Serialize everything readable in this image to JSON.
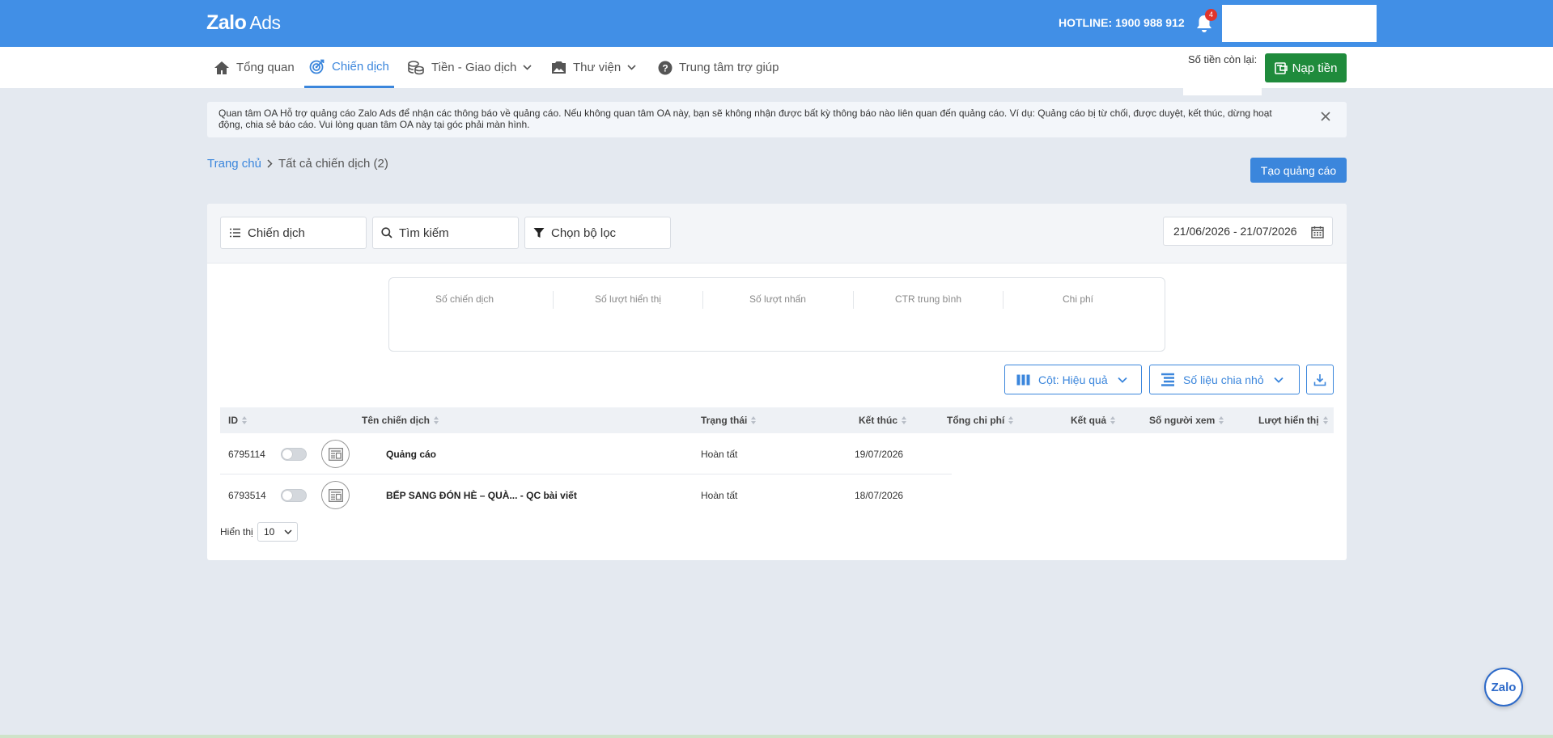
{
  "header": {
    "logo_main": "Zalo",
    "logo_sub": "Ads",
    "hotline": "HOTLINE: 1900 988 912",
    "notification_count": "4",
    "accent_color": "#418fe6"
  },
  "nav": {
    "items": [
      {
        "label": "Tổng quan",
        "icon": "home-icon"
      },
      {
        "label": "Chiến dịch",
        "icon": "target-icon",
        "active": true
      },
      {
        "label": "Tiền - Giao dịch",
        "icon": "coins-icon",
        "dropdown": true
      },
      {
        "label": "Thư viện",
        "icon": "image-icon",
        "dropdown": true
      },
      {
        "label": "Trung tâm trợ giúp",
        "icon": "help-icon"
      }
    ],
    "balance_label": "Số tiền còn lại:",
    "topup_label": "Nạp tiền"
  },
  "notice": {
    "text": "Quan tâm OA Hỗ trợ quảng cáo Zalo Ads để nhận các thông báo về quảng cáo. Nếu không quan tâm OA này, bạn sẽ không nhận được bất kỳ thông báo nào liên quan đến quảng cáo. Ví dụ: Quảng cáo bị từ chối, được duyệt, kết thúc, dừng hoạt động, chia sẻ báo cáo. Vui lòng quan tâm OA này tại góc phải màn hình."
  },
  "breadcrumb": {
    "home": "Trang chủ",
    "current": "Tất cả chiến dịch (2)"
  },
  "create_button": "Tạo quảng cáo",
  "filters": {
    "level": "Chiến dịch",
    "search_placeholder": "Tìm kiếm",
    "filter": "Chọn bộ lọc",
    "date_range": "21/06/2026 - 21/07/2026"
  },
  "summary": {
    "columns": [
      "Số chiến dịch",
      "Số lượt hiển thị",
      "Số lượt nhấn",
      "CTR trung bình",
      "Chi phí"
    ]
  },
  "tools": {
    "columns_label": "Cột: Hiệu quả",
    "breakdown_label": "Số liệu chia nhỏ"
  },
  "table": {
    "headers": {
      "id": "ID",
      "name": "Tên chiến dịch",
      "status": "Trạng thái",
      "end": "Kết thúc",
      "spend": "Tổng chi phí",
      "result": "Kết quả",
      "viewers": "Số người xem",
      "impressions": "Lượt hiển thị"
    },
    "rows": [
      {
        "id": "6795114",
        "name": "Quảng cáo",
        "status": "Hoàn tất",
        "end": "19/07/2026"
      },
      {
        "id": "6793514",
        "name": "BẾP SANG ĐÓN HÈ – QUÀ... - QC bài viết",
        "status": "Hoàn tất",
        "end": "18/07/2026"
      }
    ]
  },
  "paging": {
    "label": "Hiển thị",
    "page_size": "10"
  },
  "fab": {
    "label": "Zalo"
  }
}
